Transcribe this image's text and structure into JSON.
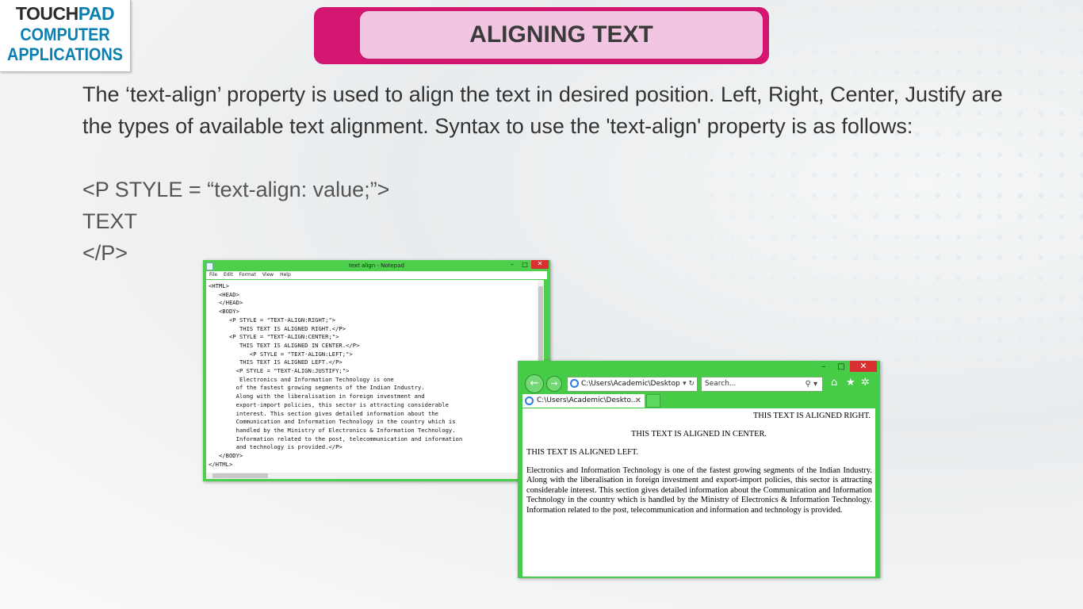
{
  "logo": {
    "brand_part1": "T",
    "brand_o": "O",
    "brand_part2": "UCH",
    "brand_part3": "PAD",
    "line1": "COMPUTER",
    "line2": "APPLICATIONS"
  },
  "slide_title": "ALIGNING TEXT",
  "description": "The ‘text-align’ property is used to align the text in desired position. Left, Right, Center, Justify are the types of available text alignment. Syntax to use the 'text-align' property is as follows:",
  "syntax": {
    "line1": "<P STYLE = “text-align: value;”>",
    "line2": "TEXT",
    "line3": "</P>"
  },
  "notepad": {
    "title": "text align - Notepad",
    "menu": [
      "File",
      "Edit",
      "Format",
      "View",
      "Help"
    ],
    "controls": {
      "minimize": "–",
      "maximize": "□",
      "close": "✕"
    },
    "code": "<HTML>\n   <HEAD>\n   </HEAD>\n   <BODY>\n      <P STYLE = \"TEXT-ALIGN:RIGHT;\">\n         THIS TEXT IS ALIGNED RIGHT.</P>\n      <P STYLE = \"TEXT-ALIGN:CENTER;\">\n         THIS TEXT IS ALIGNED IN CENTER.</P>\n            <P STYLE = \"TEXT-ALIGN:LEFT;\">\n         THIS TEXT IS ALIGNED LEFT.</P>\n        <P STYLE = \"TEXT-ALIGN:JUSTIFY;\">\n         Electronics and Information Technology is one\n        of the fastest growing segments of the Indian Industry.\n        Along with the liberalisation in foreign investment and\n        export-import policies, this sector is attracting considerable\n        interest. This section gives detailed information about the\n        Communication and Information Technology in the country which is\n        handled by the Ministry of Electronics & Information Technology.\n        Information related to the post, telecommunication and information\n        and technology is provided.</P>\n   </BODY>\n</HTML>"
  },
  "browser": {
    "controls": {
      "minimize": "–",
      "maximize": "□",
      "close": "✕"
    },
    "address": "C:\\Users\\Academic\\Desktop",
    "search_placeholder": "Search...",
    "tab_title": "C:\\Users\\Academic\\Deskto...",
    "content": {
      "right": "THIS TEXT IS ALIGNED RIGHT.",
      "center": "THIS TEXT IS ALIGNED IN CENTER.",
      "left": "THIS TEXT IS ALIGNED LEFT.",
      "justify": "Electronics and Information Technology is one of the fastest growing segments of the Indian Industry. Along with the liberalisation in foreign investment and export-import policies, this sector is attracting considerable interest. This section gives detailed information about the Communication and Information Technology in the country which is handled by the Ministry of Electronics & Information Technology. Information related to the post, telecommunication and information and technology is provided."
    }
  },
  "colors": {
    "title_border": "#d3166f",
    "title_fill": "#f2c6e2",
    "window_frame": "#4cd04c",
    "close_button": "#d9302f",
    "logo_blue": "#0a7fb0"
  }
}
